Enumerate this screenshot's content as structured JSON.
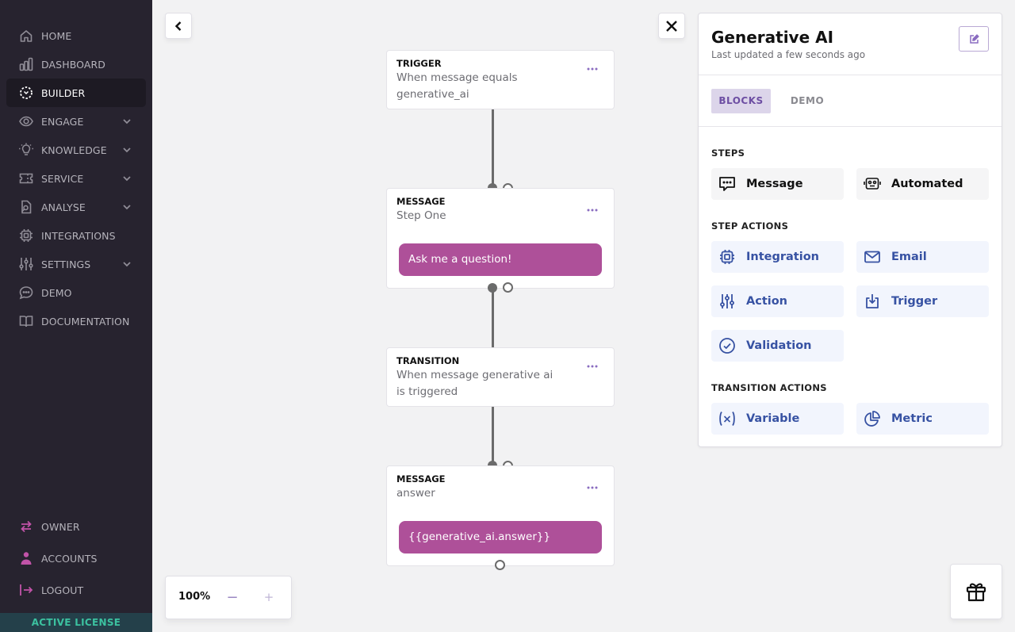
{
  "sidebar": {
    "items": [
      {
        "label": "HOME",
        "icon": "home-icon",
        "active": false,
        "expandable": false
      },
      {
        "label": "DASHBOARD",
        "icon": "bar-chart-icon",
        "active": false,
        "expandable": false
      },
      {
        "label": "BUILDER",
        "icon": "builder-icon",
        "active": true,
        "expandable": false
      },
      {
        "label": "ENGAGE",
        "icon": "eye-icon",
        "active": false,
        "expandable": true
      },
      {
        "label": "KNOWLEDGE",
        "icon": "lightbulb-icon",
        "active": false,
        "expandable": true
      },
      {
        "label": "SERVICE",
        "icon": "ticket-icon",
        "active": false,
        "expandable": true
      },
      {
        "label": "ANALYSE",
        "icon": "file-search-icon",
        "active": false,
        "expandable": true
      },
      {
        "label": "INTEGRATIONS",
        "icon": "chip-icon",
        "active": false,
        "expandable": false
      },
      {
        "label": "SETTINGS",
        "icon": "sliders-icon",
        "active": false,
        "expandable": true
      },
      {
        "label": "DEMO",
        "icon": "chat-bubble-icon",
        "active": false,
        "expandable": false
      },
      {
        "label": "DOCUMENTATION",
        "icon": "book-icon",
        "active": false,
        "expandable": false
      }
    ],
    "bottom_items": [
      {
        "label": "OWNER",
        "icon": "switch-arrows-icon"
      },
      {
        "label": "ACCOUNTS",
        "icon": "user-icon"
      },
      {
        "label": "LOGOUT",
        "icon": "logout-icon"
      }
    ],
    "license_label": "ACTIVE LICENSE",
    "accent_color": "#c153a8",
    "license_color": "#3cc2a0"
  },
  "canvas": {
    "nodes": [
      {
        "type": "TRIGGER",
        "description": "When message equals generative_ai"
      },
      {
        "type": "MESSAGE",
        "description": "Step One",
        "bubble": "Ask me a question!"
      },
      {
        "type": "TRANSITION",
        "description": "When message generative ai is triggered"
      },
      {
        "type": "MESSAGE",
        "description": "answer",
        "bubble": "{{generative_ai.answer}}"
      }
    ],
    "bubble_color": "#ae5099",
    "zoom": {
      "value": "100%",
      "minus": "−",
      "plus": "+"
    }
  },
  "panel": {
    "title": "Generative AI",
    "subtitle": "Last updated a few seconds ago",
    "tabs": [
      {
        "label": "BLOCKS",
        "active": true
      },
      {
        "label": "DEMO",
        "active": false
      }
    ],
    "sections": [
      {
        "label": "STEPS",
        "blocks": [
          {
            "label": "Message",
            "icon": "message-icon"
          },
          {
            "label": "Automated",
            "icon": "robot-icon"
          }
        ]
      },
      {
        "label": "STEP ACTIONS",
        "blocks": [
          {
            "label": "Integration",
            "icon": "chip-icon"
          },
          {
            "label": "Email",
            "icon": "mail-icon"
          },
          {
            "label": "Action",
            "icon": "sliders-icon"
          },
          {
            "label": "Trigger",
            "icon": "download-box-icon"
          },
          {
            "label": "Validation",
            "icon": "check-circle-icon"
          }
        ]
      },
      {
        "label": "TRANSITION ACTIONS",
        "blocks": [
          {
            "label": "Variable",
            "icon": "variable-icon"
          },
          {
            "label": "Metric",
            "icon": "pie-chart-icon"
          }
        ]
      }
    ],
    "action_color": "#3752a3"
  }
}
